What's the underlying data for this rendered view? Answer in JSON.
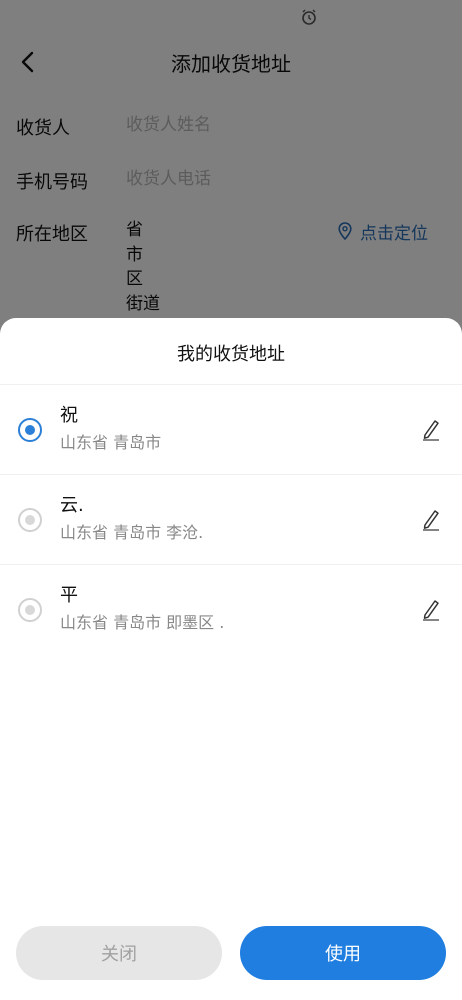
{
  "page": {
    "title": "添加收货地址",
    "form": {
      "recipient_label": "收货人",
      "recipient_placeholder": "收货人姓名",
      "phone_label": "手机号码",
      "phone_placeholder": "收货人电话",
      "region_label": "所在地区",
      "region_items": [
        "省",
        "市",
        "区",
        "街道"
      ],
      "locate_label": "点击定位"
    }
  },
  "sheet": {
    "title": "我的收货地址",
    "addresses": [
      {
        "name": "祝",
        "detail": "山东省 青岛市",
        "selected": true
      },
      {
        "name": "云.",
        "detail": "山东省 青岛市 李沧.",
        "selected": false
      },
      {
        "name": "平",
        "detail": "山东省 青岛市 即墨区 .",
        "selected": false
      }
    ],
    "close_label": "关闭",
    "use_label": "使用"
  },
  "colors": {
    "accent": "#1f7ee0",
    "link": "#2a6fb8",
    "overlay": "rgba(0,0,0,0.5)"
  }
}
